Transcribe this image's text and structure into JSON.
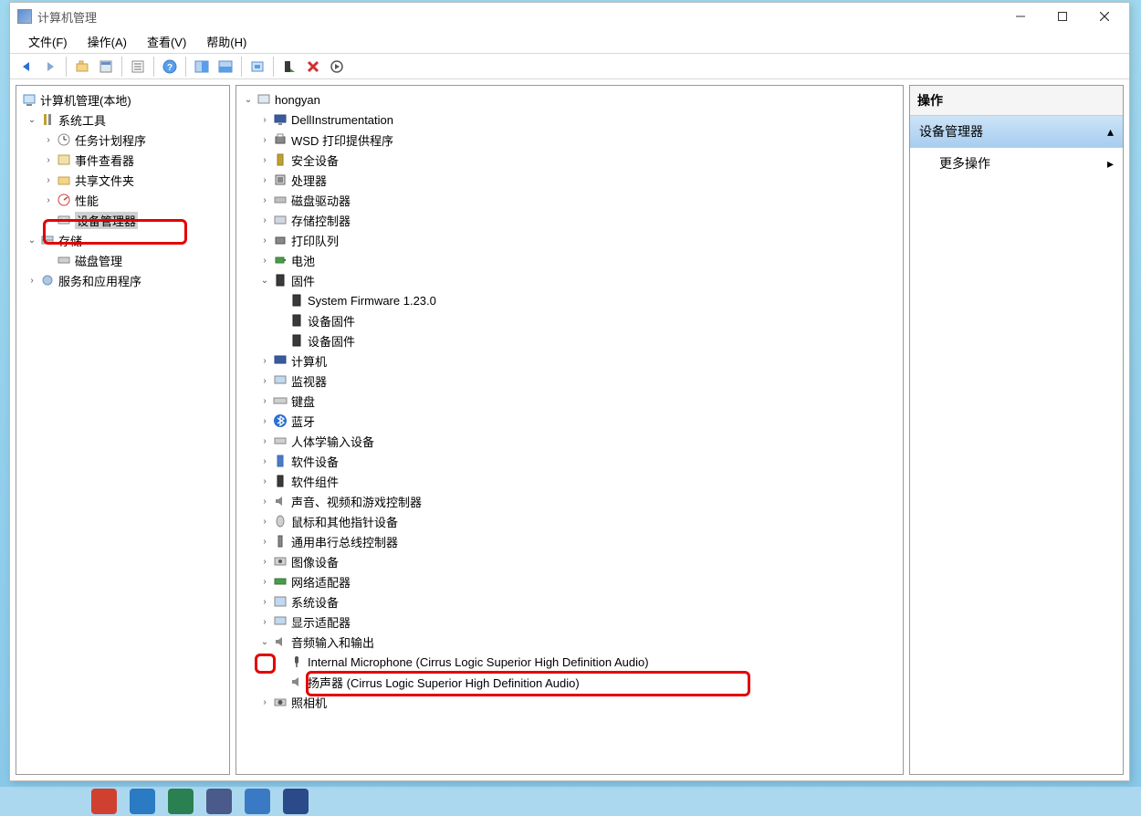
{
  "window": {
    "title": "计算机管理"
  },
  "menu": {
    "file": "文件(F)",
    "action": "操作(A)",
    "view": "查看(V)",
    "help": "帮助(H)"
  },
  "leftTree": {
    "root": "计算机管理(本地)",
    "systemTools": "系统工具",
    "taskScheduler": "任务计划程序",
    "eventViewer": "事件查看器",
    "sharedFolders": "共享文件夹",
    "performance": "性能",
    "deviceManager": "设备管理器",
    "storage": "存储",
    "diskMgmt": "磁盘管理",
    "servicesApps": "服务和应用程序"
  },
  "centerTree": {
    "root": "hongyan",
    "dellInstr": "DellInstrumentation",
    "wsdPrint": "WSD 打印提供程序",
    "security": "安全设备",
    "processor": "处理器",
    "diskDrive": "磁盘驱动器",
    "storageCtrl": "存储控制器",
    "printQueue": "打印队列",
    "battery": "电池",
    "firmware": "固件",
    "sysFirmware": "System Firmware 1.23.0",
    "devFirmware1": "设备固件",
    "devFirmware2": "设备固件",
    "computer": "计算机",
    "monitor": "监视器",
    "keyboard": "键盘",
    "bluetooth": "蓝牙",
    "hid": "人体学输入设备",
    "softDevice": "软件设备",
    "softComponent": "软件组件",
    "svg": "声音、视频和游戏控制器",
    "mouse": "鼠标和其他指针设备",
    "usb": "通用串行总线控制器",
    "imaging": "图像设备",
    "network": "网络适配器",
    "sysDevice": "系统设备",
    "display": "显示适配器",
    "audioIO": "音频输入和输出",
    "internalMic": "Internal Microphone (Cirrus Logic Superior High Definition Audio)",
    "speaker": "扬声器 (Cirrus Logic Superior High Definition Audio)",
    "camera": "照相机"
  },
  "actions": {
    "header": "操作",
    "selected": "设备管理器",
    "more": "更多操作"
  }
}
